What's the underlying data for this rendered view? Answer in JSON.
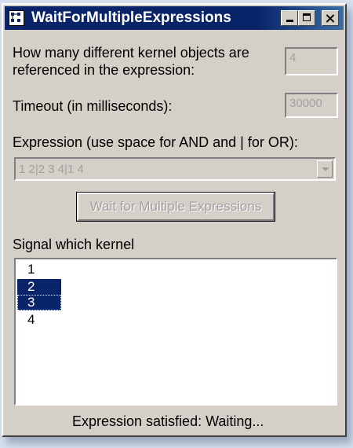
{
  "window": {
    "title": "WaitForMultipleExpressions"
  },
  "fields": {
    "kernel_count_label_1": "How many different kernel objects are",
    "kernel_count_label_2": "referenced in the expression:",
    "kernel_count_value": "4",
    "timeout_label": "Timeout (in milliseconds):",
    "timeout_value": "30000",
    "expression_label": "Expression (use space for AND and | for OR):",
    "expression_value": "1 2|2 3 4|1 4"
  },
  "wait_button": {
    "label": "Wait for Multiple Expressions",
    "enabled": false
  },
  "signal": {
    "label": "Signal which kernel",
    "items": [
      {
        "label": "1",
        "selected": false
      },
      {
        "label": "2",
        "selected": true
      },
      {
        "label": "3",
        "selected": true
      },
      {
        "label": "4",
        "selected": false
      }
    ]
  },
  "status": {
    "text": "Expression satisfied:  Waiting..."
  },
  "colors": {
    "titlebar": "#0a246a",
    "selection": "#0a246a",
    "face": "#d4d0c8",
    "disabled_text": "#a0a0a0"
  },
  "icons": {
    "app": "app-icon",
    "minimize": "minimize-icon",
    "maximize": "maximize-icon",
    "close": "close-icon",
    "dropdown": "chevron-down-icon"
  }
}
